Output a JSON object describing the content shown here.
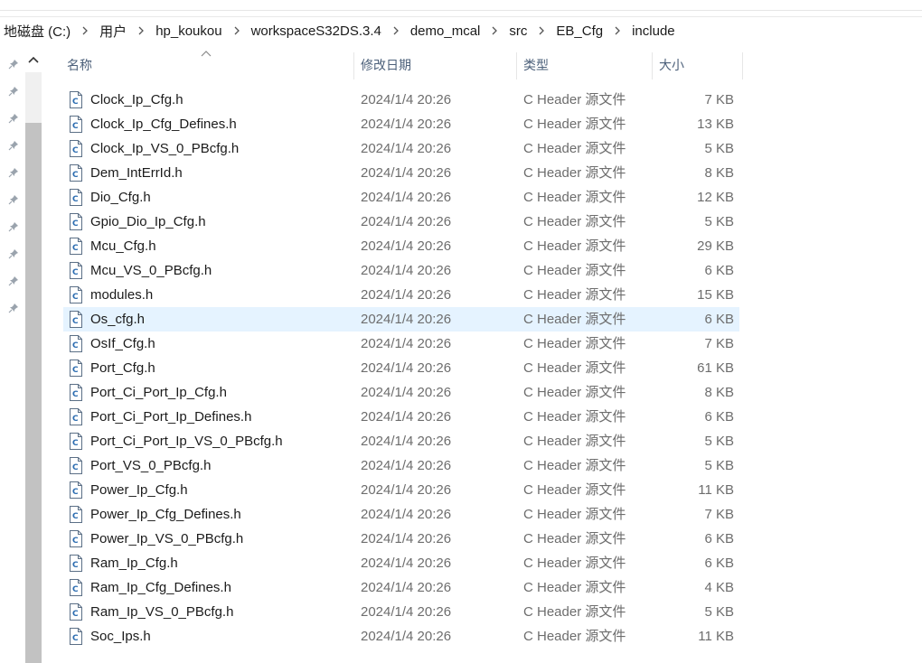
{
  "breadcrumb": [
    "地磁盘 (C:)",
    "用户",
    "hp_koukou",
    "workspaceS32DS.3.4",
    "demo_mcal",
    "src",
    "EB_Cfg",
    "include"
  ],
  "columns": {
    "name": "名称",
    "date": "修改日期",
    "type": "类型",
    "size": "大小"
  },
  "icons": {
    "separator": "chevron-right-icon",
    "pin": "pin-icon",
    "file": "c-header-file-icon",
    "scroll": "scroll-up-arrow-icon",
    "sort": "sort-ascending-icon"
  },
  "colors": {
    "selected_row": "#e5f3ff",
    "header_text": "#4c607a",
    "file_icon_stroke": "#2b6cb0"
  },
  "selected_file": "Os_cfg.h",
  "files": [
    {
      "name": "Clock_Ip_Cfg.h",
      "date": "2024/1/4 20:26",
      "type": "C Header 源文件",
      "size": "7 KB"
    },
    {
      "name": "Clock_Ip_Cfg_Defines.h",
      "date": "2024/1/4 20:26",
      "type": "C Header 源文件",
      "size": "13 KB"
    },
    {
      "name": "Clock_Ip_VS_0_PBcfg.h",
      "date": "2024/1/4 20:26",
      "type": "C Header 源文件",
      "size": "5 KB"
    },
    {
      "name": "Dem_IntErrId.h",
      "date": "2024/1/4 20:26",
      "type": "C Header 源文件",
      "size": "8 KB"
    },
    {
      "name": "Dio_Cfg.h",
      "date": "2024/1/4 20:26",
      "type": "C Header 源文件",
      "size": "12 KB"
    },
    {
      "name": "Gpio_Dio_Ip_Cfg.h",
      "date": "2024/1/4 20:26",
      "type": "C Header 源文件",
      "size": "5 KB"
    },
    {
      "name": "Mcu_Cfg.h",
      "date": "2024/1/4 20:26",
      "type": "C Header 源文件",
      "size": "29 KB"
    },
    {
      "name": "Mcu_VS_0_PBcfg.h",
      "date": "2024/1/4 20:26",
      "type": "C Header 源文件",
      "size": "6 KB"
    },
    {
      "name": "modules.h",
      "date": "2024/1/4 20:26",
      "type": "C Header 源文件",
      "size": "15 KB"
    },
    {
      "name": "Os_cfg.h",
      "date": "2024/1/4 20:26",
      "type": "C Header 源文件",
      "size": "6 KB"
    },
    {
      "name": "OsIf_Cfg.h",
      "date": "2024/1/4 20:26",
      "type": "C Header 源文件",
      "size": "7 KB"
    },
    {
      "name": "Port_Cfg.h",
      "date": "2024/1/4 20:26",
      "type": "C Header 源文件",
      "size": "61 KB"
    },
    {
      "name": "Port_Ci_Port_Ip_Cfg.h",
      "date": "2024/1/4 20:26",
      "type": "C Header 源文件",
      "size": "8 KB"
    },
    {
      "name": "Port_Ci_Port_Ip_Defines.h",
      "date": "2024/1/4 20:26",
      "type": "C Header 源文件",
      "size": "6 KB"
    },
    {
      "name": "Port_Ci_Port_Ip_VS_0_PBcfg.h",
      "date": "2024/1/4 20:26",
      "type": "C Header 源文件",
      "size": "5 KB"
    },
    {
      "name": "Port_VS_0_PBcfg.h",
      "date": "2024/1/4 20:26",
      "type": "C Header 源文件",
      "size": "5 KB"
    },
    {
      "name": "Power_Ip_Cfg.h",
      "date": "2024/1/4 20:26",
      "type": "C Header 源文件",
      "size": "11 KB"
    },
    {
      "name": "Power_Ip_Cfg_Defines.h",
      "date": "2024/1/4 20:26",
      "type": "C Header 源文件",
      "size": "7 KB"
    },
    {
      "name": "Power_Ip_VS_0_PBcfg.h",
      "date": "2024/1/4 20:26",
      "type": "C Header 源文件",
      "size": "6 KB"
    },
    {
      "name": "Ram_Ip_Cfg.h",
      "date": "2024/1/4 20:26",
      "type": "C Header 源文件",
      "size": "6 KB"
    },
    {
      "name": "Ram_Ip_Cfg_Defines.h",
      "date": "2024/1/4 20:26",
      "type": "C Header 源文件",
      "size": "4 KB"
    },
    {
      "name": "Ram_Ip_VS_0_PBcfg.h",
      "date": "2024/1/4 20:26",
      "type": "C Header 源文件",
      "size": "5 KB"
    },
    {
      "name": "Soc_Ips.h",
      "date": "2024/1/4 20:26",
      "type": "C Header 源文件",
      "size": "11 KB"
    }
  ]
}
